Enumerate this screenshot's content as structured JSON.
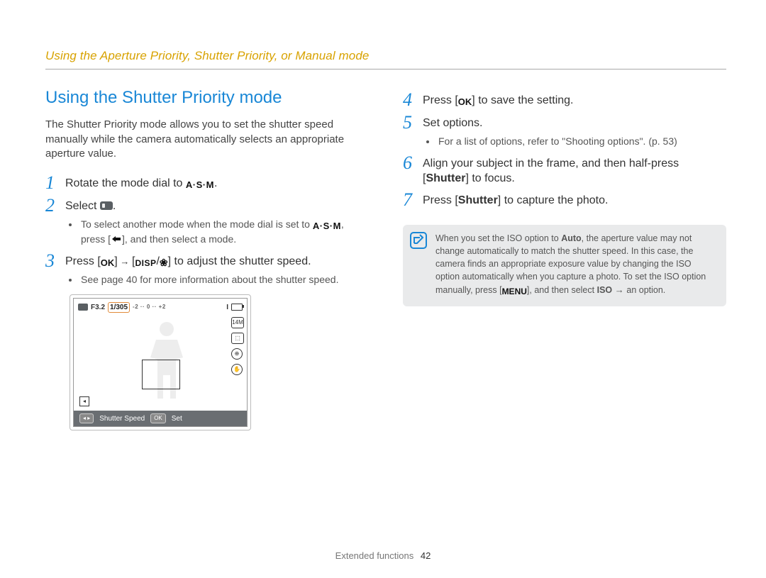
{
  "chapter_title": "Using the Aperture Priority, Shutter Priority, or Manual mode",
  "section_title": "Using the Shutter Priority mode",
  "intro": "The Shutter Priority mode allows you to set the shutter speed manually while the camera automatically selects an appropriate aperture value.",
  "steps": {
    "s1": {
      "num": "1",
      "pre": "Rotate the mode dial to ",
      "icon": "A·S·M",
      "post": "."
    },
    "s2": {
      "num": "2",
      "pre": "Select ",
      "post": "."
    },
    "s2_sub_a_pre": "To select another mode when the mode dial is set to ",
    "s2_sub_a_mid": ", press [",
    "s2_sub_a_post": "], and then select a mode.",
    "s3": {
      "num": "3",
      "pre": "Press [",
      "arrow": " → ",
      "mid": "] [",
      "slash": "/",
      "post": "] to adjust the shutter speed."
    },
    "s3_sub": "See page 40 for more information about the shutter speed.",
    "s4": {
      "num": "4",
      "pre": "Press [",
      "post": "] to save the setting."
    },
    "s5": {
      "num": "5",
      "text": "Set options."
    },
    "s5_sub": "For a list of options, refer to \"Shooting options\". (p. 53)",
    "s6": {
      "num": "6",
      "pre": "Align your subject in the frame, and then half-press [",
      "bold": "Shutter",
      "post": "] to focus."
    },
    "s7": {
      "num": "7",
      "pre": "Press [",
      "bold": "Shutter",
      "post": "] to capture the photo."
    }
  },
  "camera_screen": {
    "f_value": "F3.2",
    "shutter_value": "1/305",
    "ticks": "-2 ·· 0 ·· +2",
    "quality": "I",
    "bottom_label": "Shutter Speed",
    "bottom_action": "Set",
    "side": {
      "a": "14M",
      "b": "⬚",
      "c": "⊕",
      "d": "✋"
    }
  },
  "note": {
    "pre": "When you set the ISO option to ",
    "auto": "Auto",
    "mid1": ", the aperture value may not change automatically to match the shutter speed. In this case, the camera finds an appropriate exposure value by changing the ISO option automatically when you capture a photo. To set the ISO option manually, press [",
    "menu": "MENU",
    "mid2": "], and then select ",
    "iso": "ISO",
    "arrow": " → ",
    "post": "an option."
  },
  "footer": {
    "section": "Extended functions",
    "page": "42"
  },
  "icons": {
    "ok": "OK",
    "disp": "DISP",
    "asm": "A·S·M"
  }
}
